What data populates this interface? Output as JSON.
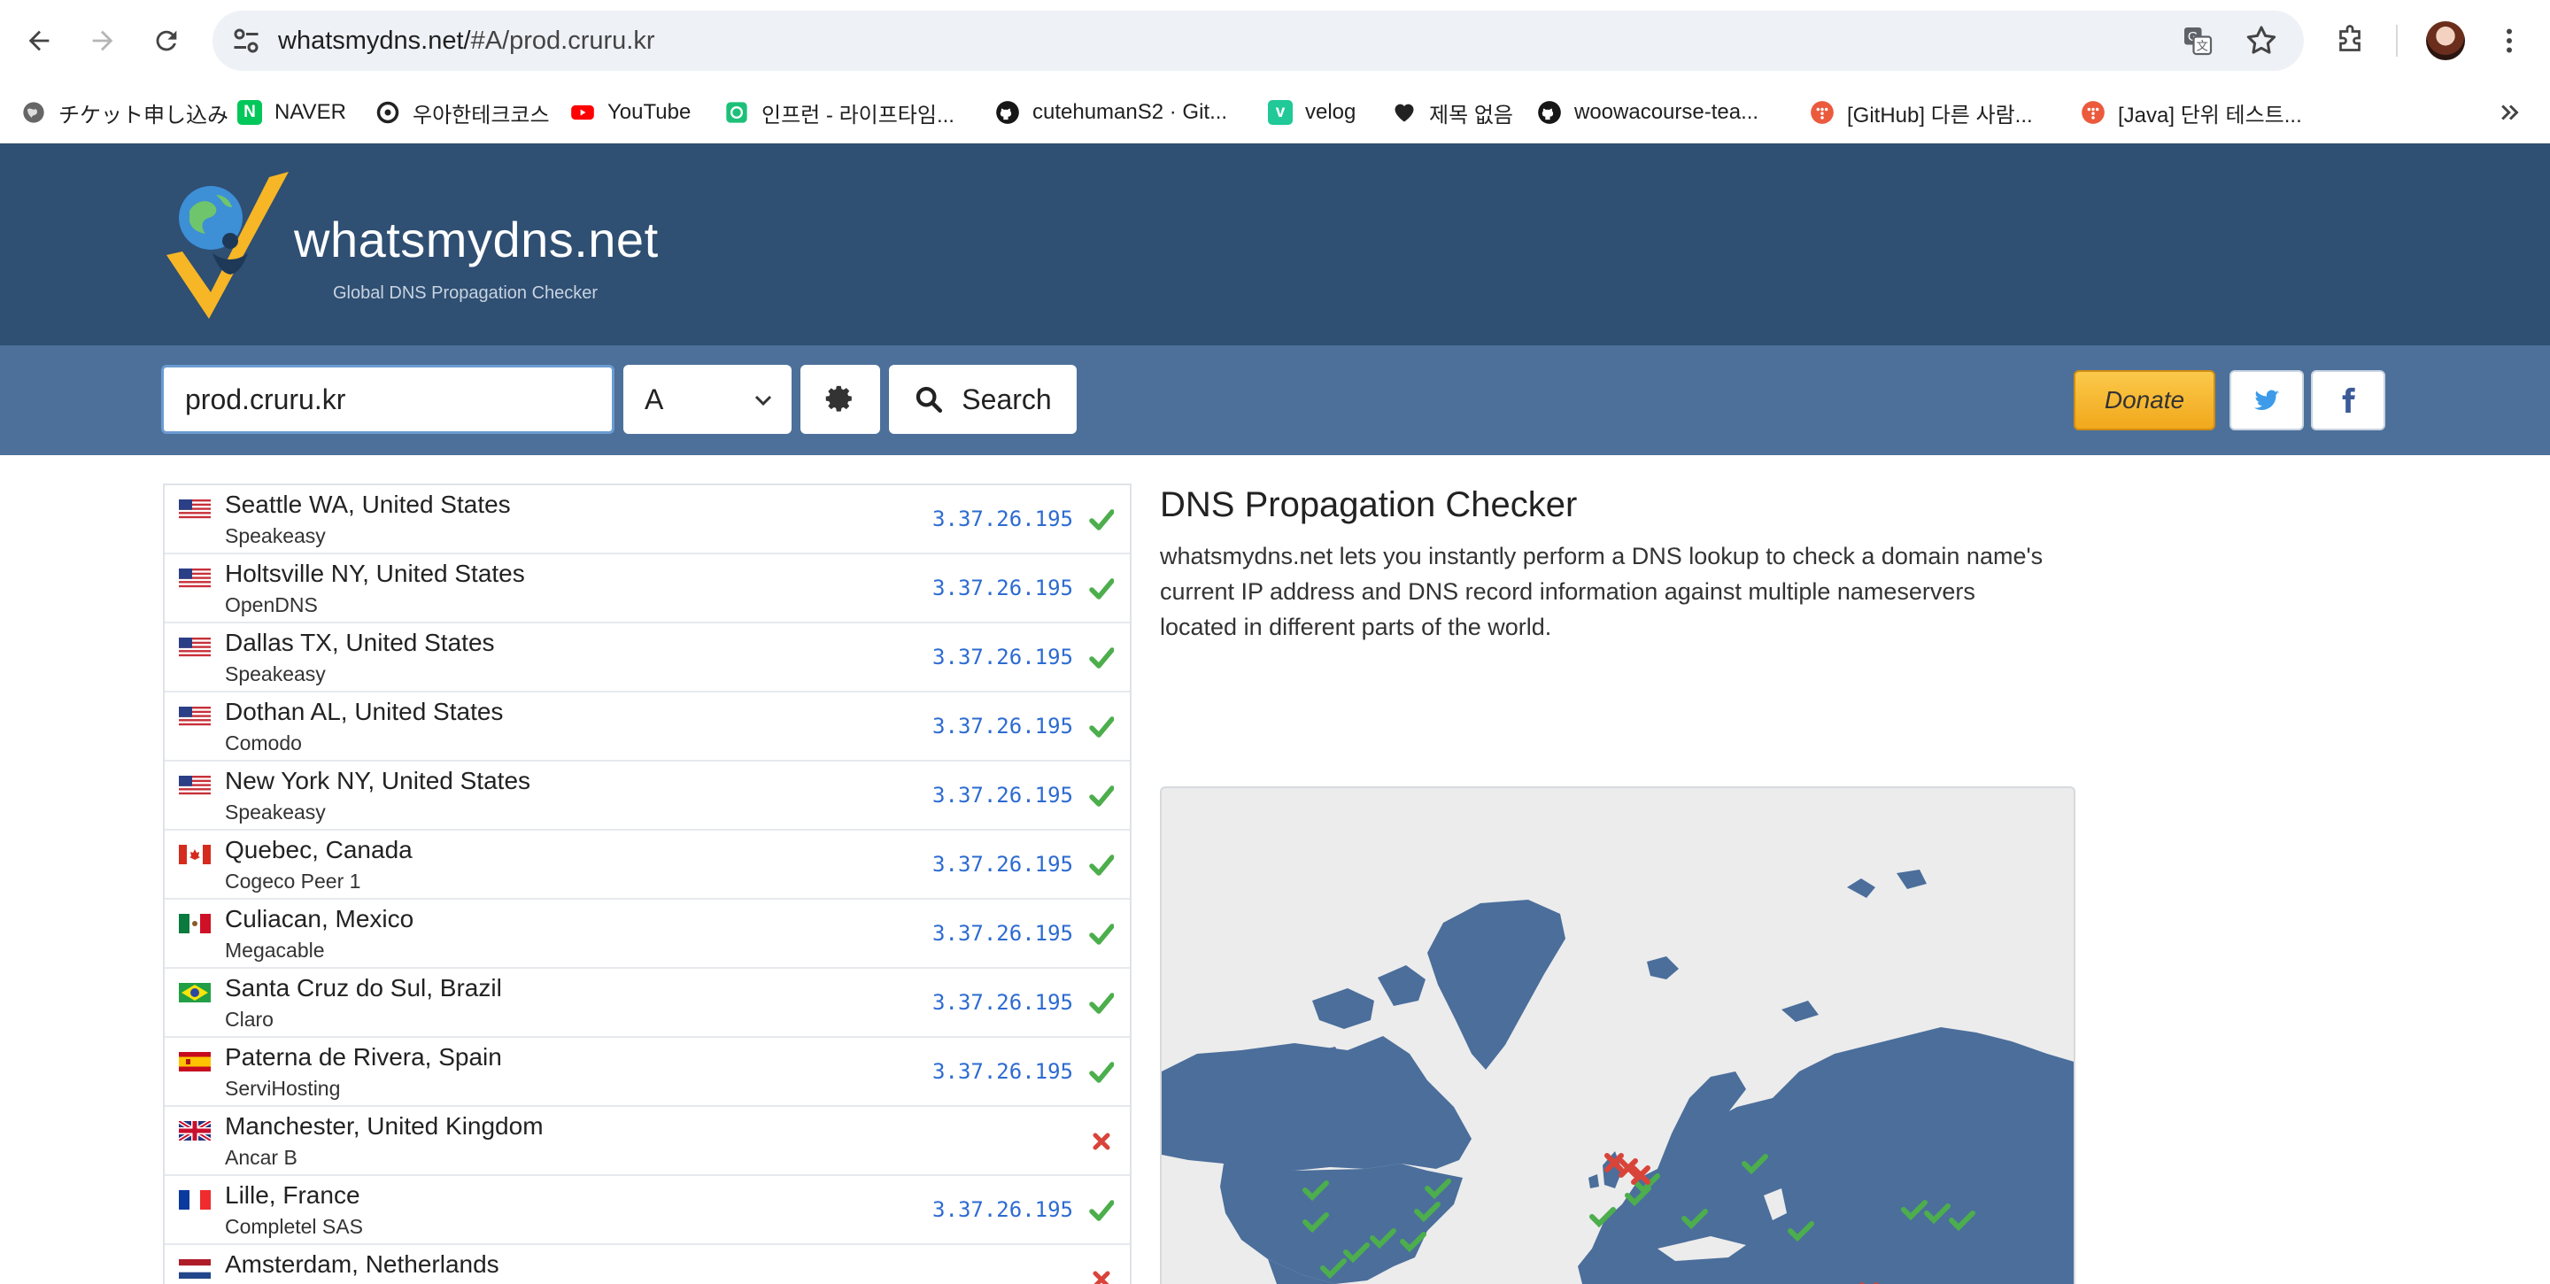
{
  "browser": {
    "url_host": "whatsmydns.net/",
    "url_path": "#A/prod.cruru.kr"
  },
  "bookmarks": [
    {
      "label": "チケット申し込み",
      "icon": "globe-icon",
      "color": "#555555"
    },
    {
      "label": "NAVER",
      "icon": "naver-icon",
      "color": "#03c75a",
      "glyph": "N"
    },
    {
      "label": "우아한테크코스",
      "icon": "woowa-icon",
      "color": "#222222"
    },
    {
      "label": "YouTube",
      "icon": "youtube-icon",
      "color": "#ff0000"
    },
    {
      "label": "인프런 - 라이프타임...",
      "icon": "inflearn-icon",
      "color": "#1dc078"
    },
    {
      "label": "cutehumanS2 · Git...",
      "icon": "github-icon",
      "color": "#181717"
    },
    {
      "label": "velog",
      "icon": "velog-icon",
      "color": "#20c997",
      "glyph": "v"
    },
    {
      "label": "제목 없음",
      "icon": "heart-icon",
      "color": "#222222"
    },
    {
      "label": "woowacourse-tea...",
      "icon": "github-icon",
      "color": "#181717"
    },
    {
      "label": "[GitHub] 다른 사람...",
      "icon": "tistory-icon",
      "color": "#eb5a3d"
    },
    {
      "label": "[Java] 단위 테스트...",
      "icon": "tistory-icon",
      "color": "#eb5a3d"
    }
  ],
  "header": {
    "brand": "whatsmydns.net",
    "tagline": "Global DNS Propagation Checker"
  },
  "search": {
    "domain_value": "prod.cruru.kr",
    "record_type": "A",
    "search_label": "Search",
    "donate_label": "Donate"
  },
  "results": [
    {
      "location": "Seattle WA, United States",
      "provider": "Speakeasy",
      "ip": "3.37.26.195",
      "status": "ok",
      "flag": "us"
    },
    {
      "location": "Holtsville NY, United States",
      "provider": "OpenDNS",
      "ip": "3.37.26.195",
      "status": "ok",
      "flag": "us"
    },
    {
      "location": "Dallas TX, United States",
      "provider": "Speakeasy",
      "ip": "3.37.26.195",
      "status": "ok",
      "flag": "us"
    },
    {
      "location": "Dothan AL, United States",
      "provider": "Comodo",
      "ip": "3.37.26.195",
      "status": "ok",
      "flag": "us"
    },
    {
      "location": "New York NY, United States",
      "provider": "Speakeasy",
      "ip": "3.37.26.195",
      "status": "ok",
      "flag": "us"
    },
    {
      "location": "Quebec, Canada",
      "provider": "Cogeco Peer 1",
      "ip": "3.37.26.195",
      "status": "ok",
      "flag": "ca"
    },
    {
      "location": "Culiacan, Mexico",
      "provider": "Megacable",
      "ip": "3.37.26.195",
      "status": "ok",
      "flag": "mx"
    },
    {
      "location": "Santa Cruz do Sul, Brazil",
      "provider": "Claro",
      "ip": "3.37.26.195",
      "status": "ok",
      "flag": "br"
    },
    {
      "location": "Paterna de Rivera, Spain",
      "provider": "ServiHosting",
      "ip": "3.37.26.195",
      "status": "ok",
      "flag": "es"
    },
    {
      "location": "Manchester, United Kingdom",
      "provider": "Ancar B",
      "ip": "",
      "status": "fail",
      "flag": "gb"
    },
    {
      "location": "Lille, France",
      "provider": "Completel SAS",
      "ip": "3.37.26.195",
      "status": "ok",
      "flag": "fr"
    },
    {
      "location": "Amsterdam, Netherlands",
      "provider": "",
      "ip": "",
      "status": "fail",
      "flag": "nl"
    }
  ],
  "info": {
    "title": "DNS Propagation Checker",
    "description": "whatsmydns.net lets you instantly perform a DNS lookup to check a domain name's current IP address and DNS record information against multiple nameservers located in different parts of the world."
  },
  "colors": {
    "header_bg": "#2f4f73",
    "searchbar_bg": "#4c709a",
    "ip_text": "#2d6bd1",
    "ok_green": "#4cae4c",
    "fail_red": "#d9443a",
    "map_land": "#4b6e9b"
  }
}
